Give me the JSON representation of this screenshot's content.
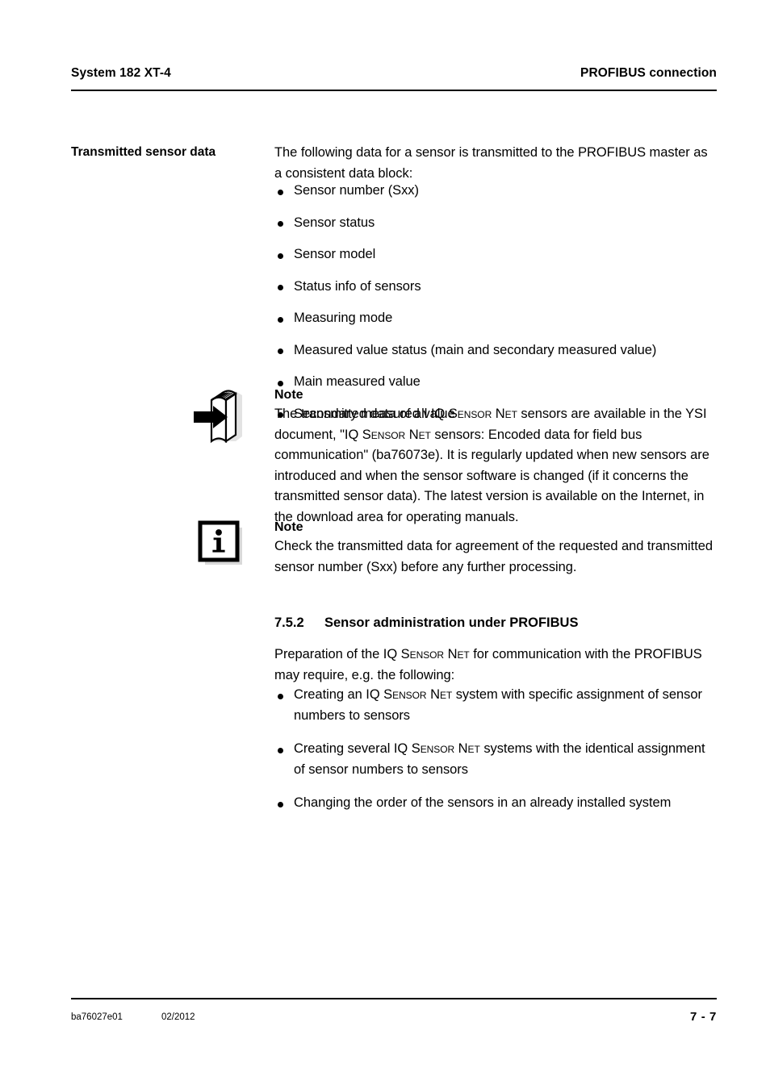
{
  "header": {
    "left": "System 182 XT-4",
    "right": "PROFIBUS connection"
  },
  "footer": {
    "doc_number": "ba76027e01",
    "date": "02/2012",
    "page": "7 - 7"
  },
  "margin_label": "Transmitted sensor data",
  "intro": {
    "paragraph": "The following data for a sensor is transmitted to the PROFIBUS master as a consistent data block:"
  },
  "sensor_data_list": [
    "Sensor number (Sxx)",
    "Sensor status",
    "Sensor model",
    "Status info of sensors",
    "Measuring mode",
    "Measured value status (main and secondary measured value)",
    "Main measured value",
    "Secondary measured value"
  ],
  "note_book": {
    "icon": "book-with-arrow-icon",
    "title": "Note",
    "text_part1": "The transmitted data of all IQ ",
    "sc1": "Sensor",
    "text_part2": " ",
    "sc2": "Net",
    "text_part3": " sensors are available in the YSI document, \"IQ ",
    "sc3": "Sensor",
    "text_part4": " ",
    "sc4": "Net",
    "text_part5": " sensors: Encoded data for field bus communication\" (ba76073e). It is regularly updated when new sensors are introduced and when the sensor software is changed (if it concerns the transmitted sensor data). The latest version is available on the Internet, in the download area for operating manuals."
  },
  "note_info": {
    "icon": "info-icon",
    "title": "Note",
    "text": "Check the transmitted data for agreement of the requested and transmitted sensor number (Sxx) before any further processing."
  },
  "section": {
    "number": "7.5.2",
    "title": "Sensor administration under PROFIBUS",
    "intro_part1": "Preparation of the IQ ",
    "intro_sc1": "Sensor",
    "intro_part2": " ",
    "intro_sc2": "Net",
    "intro_part3": " for communication with the PROFIBUS may require, e.g. the following:"
  },
  "admin_list": [
    {
      "part1": "Creating an IQ ",
      "sc1": "Sensor",
      "part2": " ",
      "sc2": "Net",
      "part3": " system with specific assignment of sensor numbers to sensors"
    },
    {
      "part1": "Creating several IQ ",
      "sc1": "Sensor",
      "part2": " ",
      "sc2": "Net",
      "part3": " systems with the identical assignment of sensor numbers to sensors"
    },
    {
      "part1": "Changing the order of the sensors in an already installed system",
      "sc1": "",
      "part2": "",
      "sc2": "",
      "part3": ""
    }
  ],
  "colors": {
    "text": "#000000",
    "page_background": "#ffffff",
    "icon_shadow": "#d9d9d9"
  }
}
